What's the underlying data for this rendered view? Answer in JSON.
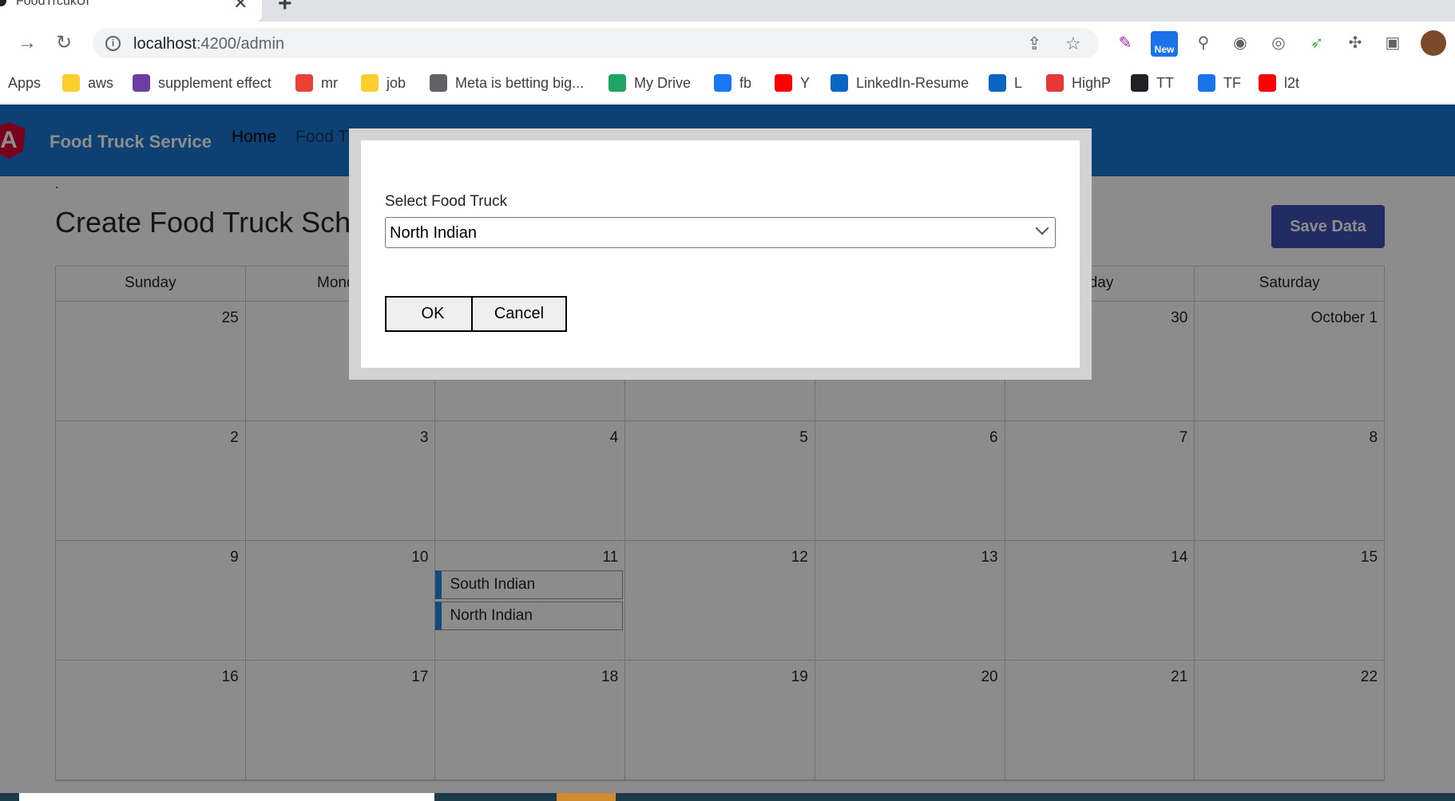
{
  "browser": {
    "tab_title": "FoodTrcukUI",
    "close_glyph": "✕",
    "newtab_glyph": "+",
    "url_host": "localhost",
    "url_path": ":4200/admin",
    "badge_new": "New"
  },
  "bookmarks": [
    {
      "label": "Apps",
      "icon": "apps-grid-icon",
      "color": "#5f6368"
    },
    {
      "label": "aws",
      "icon": "folder-icon",
      "color": "#f9ce2e"
    },
    {
      "label": "supplement effect",
      "icon": "excel-icon",
      "color": "#6b3fa0"
    },
    {
      "label": "mr",
      "icon": "gmail-icon",
      "color": "#ea4335"
    },
    {
      "label": "job",
      "icon": "folder-icon",
      "color": "#f9ce2e"
    },
    {
      "label": "Meta is betting big...",
      "icon": "globe-icon",
      "color": "#5f6368"
    },
    {
      "label": "My Drive",
      "icon": "drive-icon",
      "color": "#1fa463"
    },
    {
      "label": "fb",
      "icon": "facebook-icon",
      "color": "#1877f2"
    },
    {
      "label": "Y",
      "icon": "youtube-icon",
      "color": "#ff0000"
    },
    {
      "label": "LinkedIn-Resume",
      "icon": "linkedin-icon",
      "color": "#0a66c2"
    },
    {
      "label": "L",
      "icon": "linkedin-icon",
      "color": "#0a66c2"
    },
    {
      "label": "HighP",
      "icon": "highp-icon",
      "color": "#e53935"
    },
    {
      "label": "TT",
      "icon": "tt-icon",
      "color": "#202124"
    },
    {
      "label": "TF",
      "icon": "tf-icon",
      "color": "#1a73e8"
    },
    {
      "label": "l2t",
      "icon": "youtube-icon",
      "color": "#ff0000"
    }
  ],
  "app": {
    "logo_letter": "A",
    "brand": "Food Truck Service",
    "nav": [
      "Home",
      "Food Tr"
    ],
    "dot": ".",
    "page_title": "Create Food Truck Sche",
    "save_label": "Save Data"
  },
  "calendar": {
    "weekdays": [
      "Sunday",
      "Monda",
      "",
      "",
      "",
      "iday",
      "Saturday"
    ],
    "weeks": [
      [
        {
          "day": "25"
        },
        {
          "day": ""
        },
        {
          "day": ""
        },
        {
          "day": ""
        },
        {
          "day": ""
        },
        {
          "day": "30"
        },
        {
          "day": "October 1"
        }
      ],
      [
        {
          "day": "2"
        },
        {
          "day": "3"
        },
        {
          "day": "4"
        },
        {
          "day": "5"
        },
        {
          "day": "6"
        },
        {
          "day": "7"
        },
        {
          "day": "8"
        }
      ],
      [
        {
          "day": "9"
        },
        {
          "day": "10"
        },
        {
          "day": "11",
          "events": [
            "South Indian",
            "North Indian"
          ]
        },
        {
          "day": "12"
        },
        {
          "day": "13"
        },
        {
          "day": "14"
        },
        {
          "day": "15"
        }
      ],
      [
        {
          "day": "16"
        },
        {
          "day": "17"
        },
        {
          "day": "18"
        },
        {
          "day": "19"
        },
        {
          "day": "20"
        },
        {
          "day": "21"
        },
        {
          "day": "22"
        }
      ]
    ]
  },
  "dialog": {
    "label": "Select Food Truck",
    "selected": "North Indian",
    "ok": "OK",
    "cancel": "Cancel"
  }
}
